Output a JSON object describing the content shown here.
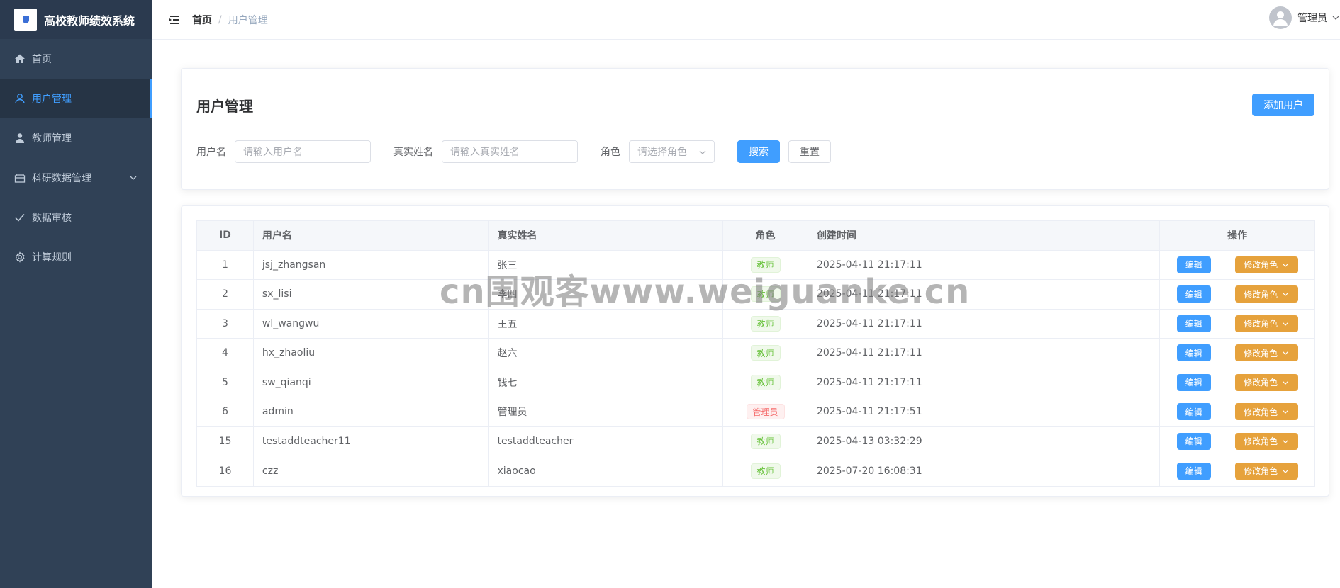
{
  "app": {
    "title": "高校教师绩效系统"
  },
  "sidebar": {
    "items": [
      {
        "label": "首页",
        "icon": "home-icon"
      },
      {
        "label": "用户管理",
        "icon": "user-icon",
        "active": true
      },
      {
        "label": "教师管理",
        "icon": "teacher-icon"
      },
      {
        "label": "科研数据管理",
        "icon": "box-icon",
        "has_submenu": true
      },
      {
        "label": "数据审核",
        "icon": "check-icon"
      },
      {
        "label": "计算规则",
        "icon": "gear-icon"
      }
    ]
  },
  "header": {
    "breadcrumb_home": "首页",
    "breadcrumb_separator": "/",
    "breadcrumb_current": "用户管理",
    "user_name": "管理员"
  },
  "search": {
    "title": "用户管理",
    "add_button": "添加用户",
    "username_label": "用户名",
    "username_placeholder": "请输入用户名",
    "realname_label": "真实姓名",
    "realname_placeholder": "请输入真实姓名",
    "role_label": "角色",
    "role_placeholder": "请选择角色",
    "search_button": "搜索",
    "reset_button": "重置"
  },
  "table": {
    "headers": [
      "ID",
      "用户名",
      "真实姓名",
      "角色",
      "创建时间",
      "操作"
    ],
    "edit_label": "编辑",
    "change_role_label": "修改角色",
    "rows": [
      {
        "id": "1",
        "username": "jsj_zhangsan",
        "realname": "张三",
        "role": "教师",
        "created": "2025-04-11 21:17:11"
      },
      {
        "id": "2",
        "username": "sx_lisi",
        "realname": "李四",
        "role": "教师",
        "created": "2025-04-11 21:17:11"
      },
      {
        "id": "3",
        "username": "wl_wangwu",
        "realname": "王五",
        "role": "教师",
        "created": "2025-04-11 21:17:11"
      },
      {
        "id": "4",
        "username": "hx_zhaoliu",
        "realname": "赵六",
        "role": "教师",
        "created": "2025-04-11 21:17:11"
      },
      {
        "id": "5",
        "username": "sw_qianqi",
        "realname": "钱七",
        "role": "教师",
        "created": "2025-04-11 21:17:11"
      },
      {
        "id": "6",
        "username": "admin",
        "realname": "管理员",
        "role": "管理员",
        "created": "2025-04-11 21:17:51"
      },
      {
        "id": "15",
        "username": "testaddteacher11",
        "realname": "testaddteacher",
        "role": "教师",
        "created": "2025-04-13 03:32:29"
      },
      {
        "id": "16",
        "username": "czz",
        "realname": "xiaocao",
        "role": "教师",
        "created": "2025-07-20 16:08:31"
      }
    ]
  },
  "watermark": "cn围观客www.weiguanke.cn",
  "colors": {
    "sidebar_bg": "#304156",
    "primary": "#409eff",
    "warning": "#e6a23c",
    "success": "#67c23a",
    "danger": "#f56c6c"
  }
}
